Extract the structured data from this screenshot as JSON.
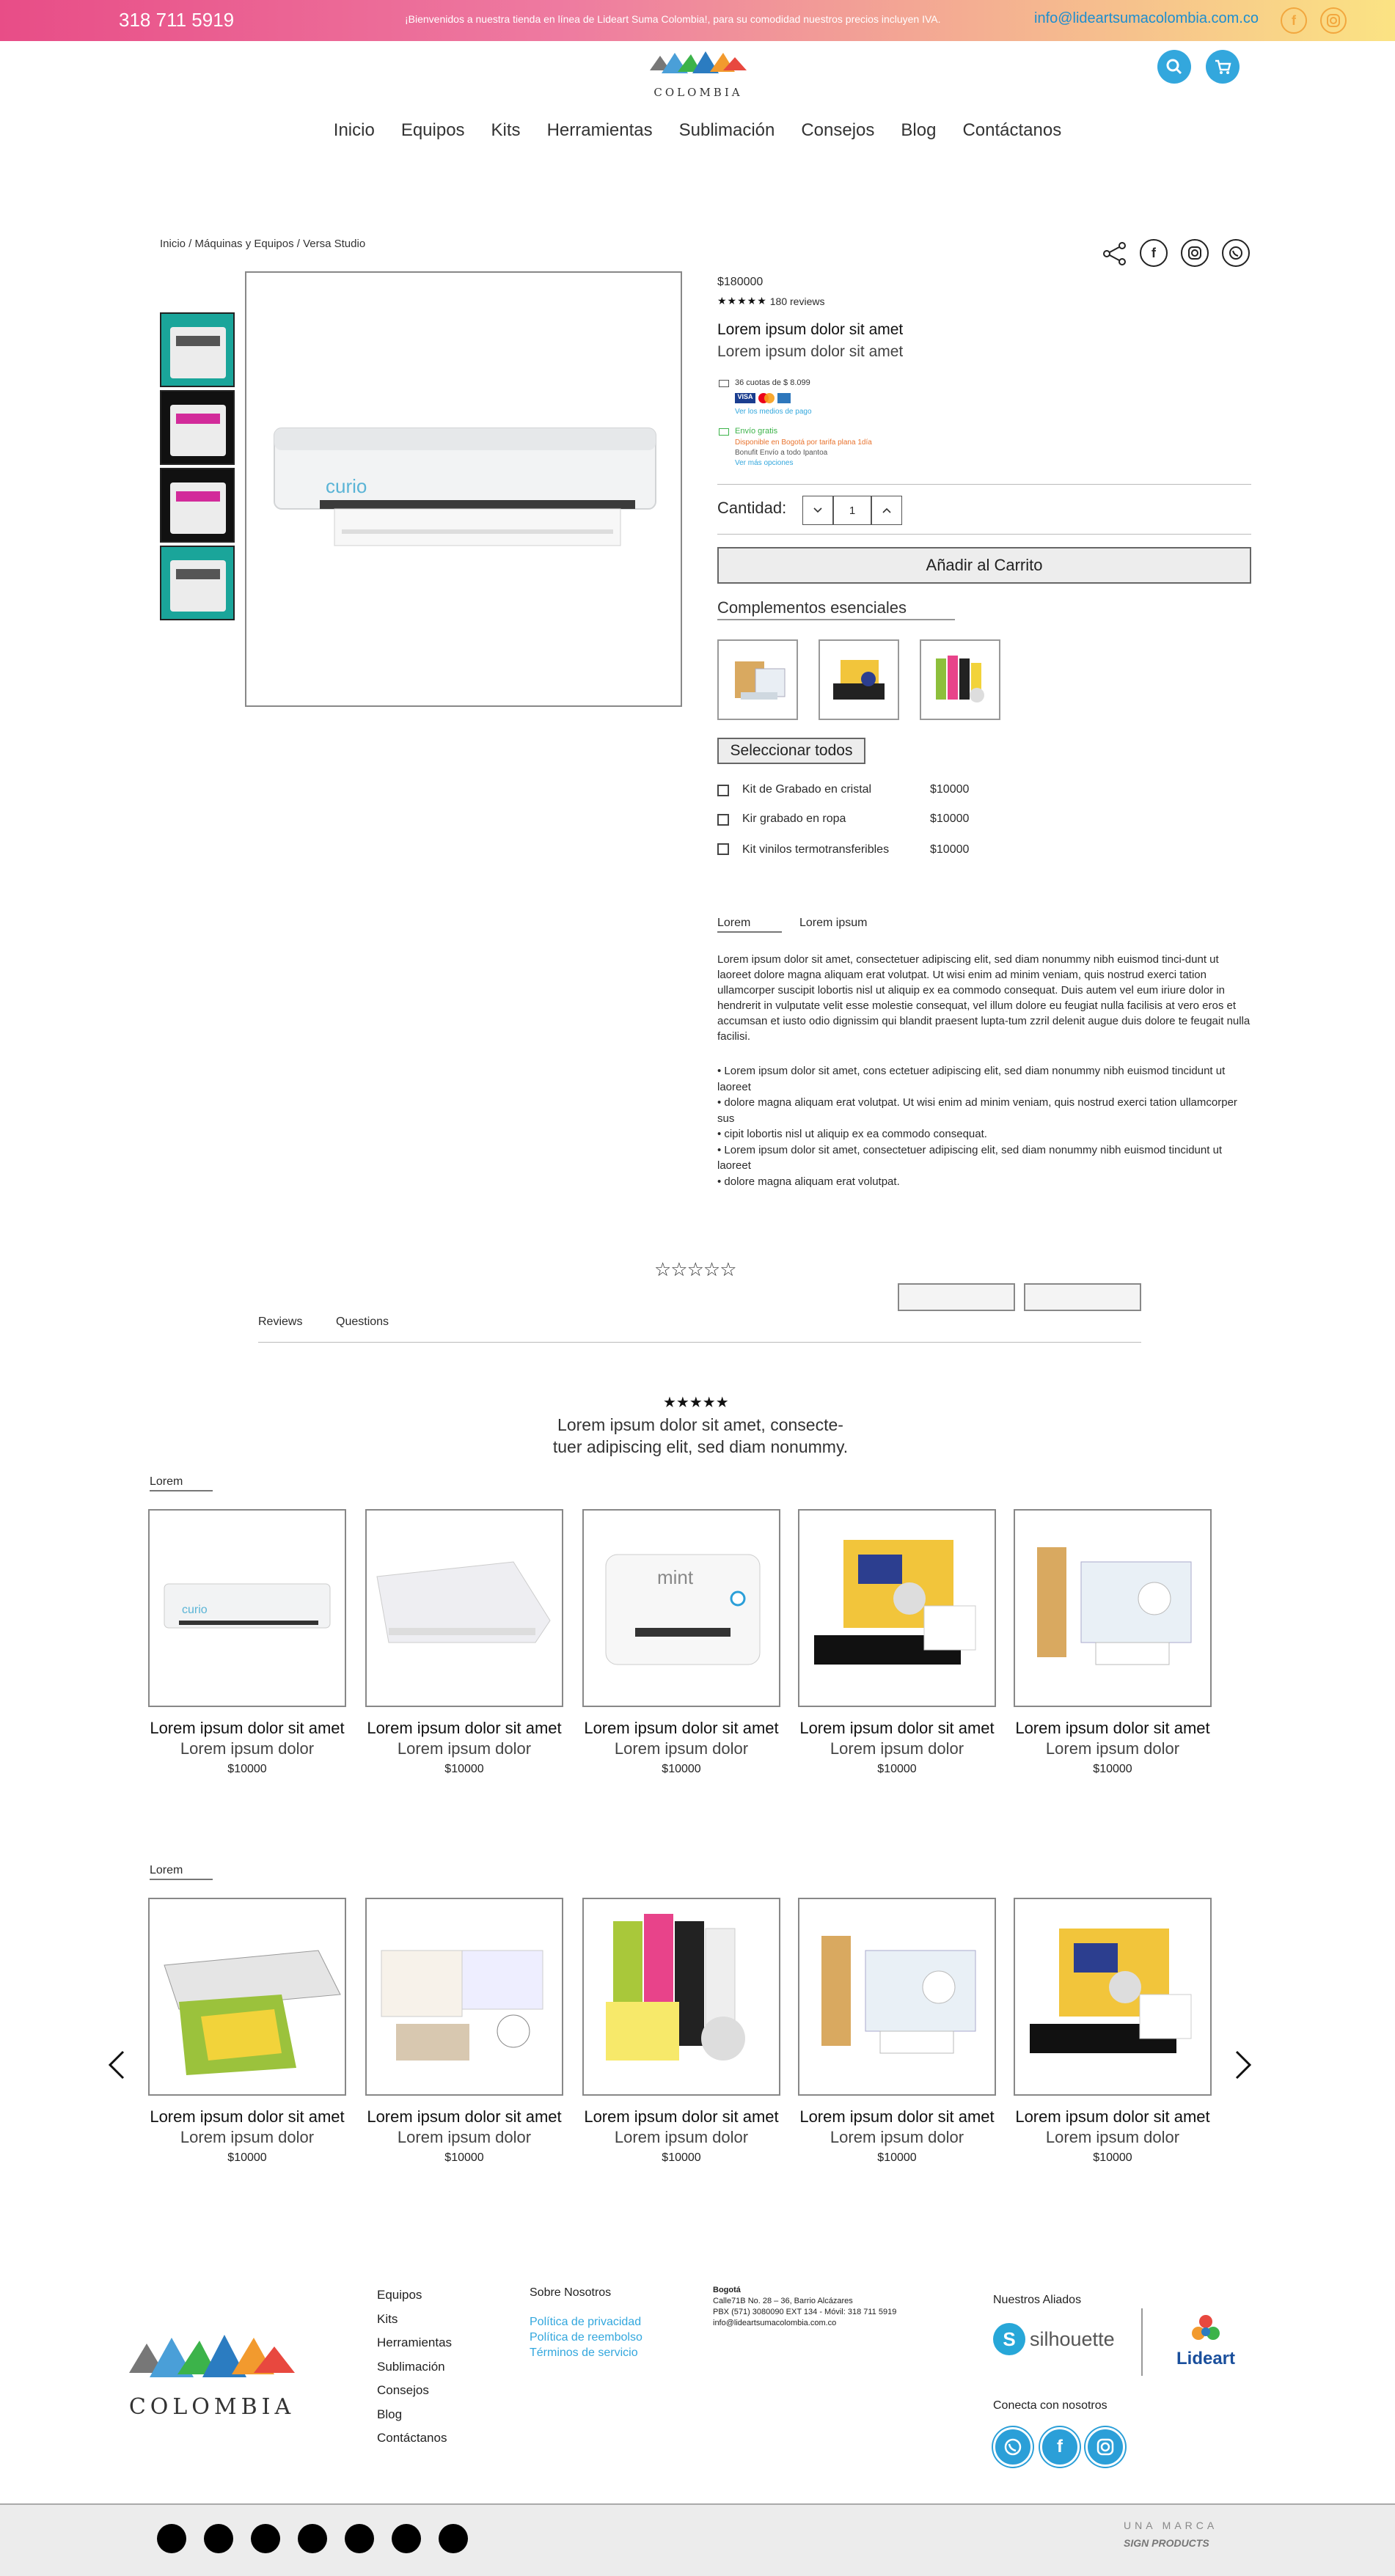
{
  "topbar": {
    "phone": "318 711 5919",
    "welcome": "¡Bienvenidos a nuestra tienda en línea de Lideart Suma Colombia!, para su comodidad nuestros precios incluyen IVA.",
    "email": "info@lideartsumacolombia.com.co",
    "social": [
      "facebook-icon",
      "instagram-icon"
    ]
  },
  "header": {
    "logo_text": "COLOMBIA",
    "nav": [
      "Inicio",
      "Equipos",
      "Kits",
      "Herramientas",
      "Sublimación",
      "Consejos",
      "Blog",
      "Contáctanos"
    ]
  },
  "breadcrumb": "Inicio /  Máquinas y Equipos / Versa Studio",
  "product": {
    "price": "$180000",
    "rating": 5,
    "reviews_count": "180 reviews",
    "title": "Lorem ipsum dolor sit amet",
    "subtitle": "Lorem ipsum dolor sit amet",
    "installments": "36 cuotas de $ 8.099",
    "payment_link": "Ver los medios de pago",
    "shipping_title": "Envío gratis",
    "shipping_line1": "Disponible en Bogotá por tarifa plana 1día",
    "shipping_line2": "Bonufit Envío a todo Ipantoa",
    "shipping_link": "Ver más opciones",
    "qty_label": "Cantidad:",
    "qty_value": "1",
    "cart_button": "Añadir al Carrito",
    "complements_title": "Complementos esenciales",
    "select_all": "Seleccionar todos",
    "addons": [
      {
        "label": "Kit de Grabado en cristal",
        "price": "$10000"
      },
      {
        "label": "Kir grabado en ropa",
        "price": "$10000"
      },
      {
        "label": "Kit vinilos termotransferibles",
        "price": "$10000"
      }
    ],
    "tabs": [
      "Lorem",
      "Lorem ipsum"
    ],
    "description": "Lorem ipsum dolor sit amet, consectetuer adipiscing elit, sed diam nonummy nibh euismod tinci-dunt ut laoreet dolore magna aliquam erat volutpat. Ut wisi enim ad minim veniam, quis nostrud exerci tation ullamcorper suscipit lobortis nisl ut aliquip ex ea commodo consequat. Duis autem vel eum iriure dolor in hendrerit in vulputate velit esse molestie consequat, vel illum dolore eu feugiat nulla facilisis at vero eros et accumsan et iusto odio dignissim qui blandit praesent lupta-tum zzril delenit augue duis dolore te feugait nulla facilisi.",
    "bullets": [
      "• Lorem ipsum dolor sit amet, cons ectetuer adipiscing elit, sed diam nonummy nibh euismod tincidunt ut laoreet",
      "• dolore magna aliquam erat volutpat. Ut wisi enim ad minim veniam, quis nostrud exerci tation ullamcorper sus",
      "• cipit lobortis nisl ut aliquip ex ea commodo consequat.",
      "• Lorem ipsum dolor sit amet, consectetuer adipiscing elit, sed diam nonummy nibh euismod tincidunt ut laoreet",
      "• dolore magna aliquam erat volutpat."
    ]
  },
  "reviews": {
    "tabs": [
      "Reviews",
      "Questions"
    ],
    "quote": "Lorem ipsum dolor sit amet, consecte-\ntuer adipiscing elit, sed diam nonummy."
  },
  "section1": {
    "label": "Lorem",
    "products": [
      {
        "name": "Lorem ipsum dolor sit amet",
        "sub": "Lorem ipsum dolor",
        "price": "$10000",
        "img": "curio"
      },
      {
        "name": "Lorem ipsum dolor sit amet",
        "sub": "Lorem ipsum dolor",
        "price": "$10000",
        "img": "portrait"
      },
      {
        "name": "Lorem ipsum dolor sit amet",
        "sub": "Lorem ipsum dolor",
        "price": "$10000",
        "img": "mint"
      },
      {
        "name": "Lorem ipsum dolor sit amet",
        "sub": "Lorem ipsum dolor",
        "price": "$10000",
        "img": "kit"
      },
      {
        "name": "Lorem ipsum dolor sit amet",
        "sub": "Lorem ipsum dolor",
        "price": "$10000",
        "img": "kit2"
      }
    ]
  },
  "section2": {
    "label": "Lorem",
    "products": [
      {
        "name": "Lorem ipsum dolor sit amet",
        "sub": "Lorem ipsum dolor",
        "price": "$10000",
        "img": "laminator"
      },
      {
        "name": "Lorem ipsum dolor sit amet",
        "sub": "Lorem ipsum dolor",
        "price": "$10000",
        "img": "kit3"
      },
      {
        "name": "Lorem ipsum dolor sit amet",
        "sub": "Lorem ipsum dolor",
        "price": "$10000",
        "img": "ideas"
      },
      {
        "name": "Lorem ipsum dolor sit amet",
        "sub": "Lorem ipsum dolor",
        "price": "$10000",
        "img": "kit2"
      },
      {
        "name": "Lorem ipsum dolor sit amet",
        "sub": "Lorem ipsum dolor",
        "price": "$10000",
        "img": "kit"
      }
    ]
  },
  "footer": {
    "logo_text": "COLOMBIA",
    "links": [
      "Equipos",
      "Kits",
      "Herramientas",
      "Sublimación",
      "Consejos",
      "Blog",
      "Contáctanos"
    ],
    "about_title": "Sobre Nosotros",
    "about_links": [
      "Política de privacidad",
      "Política de reembolso",
      "Términos de servicio"
    ],
    "city": "Bogotá",
    "address": "Calle71B No. 28 – 36, Barrio Alcázares",
    "phones": "PBX (571) 3080090 EXT 134 - Móvil: 318 711 5919",
    "mail": "info@lideartsumacolombia.com.co",
    "allies_title": "Nuestros Aliados",
    "ally1": "silhouette",
    "ally2": "Lideart",
    "connect_title": "Conecta con nosotros",
    "brand_line1": "UNA MARCA",
    "brand_line2": "SIGN PRODUCTS"
  }
}
